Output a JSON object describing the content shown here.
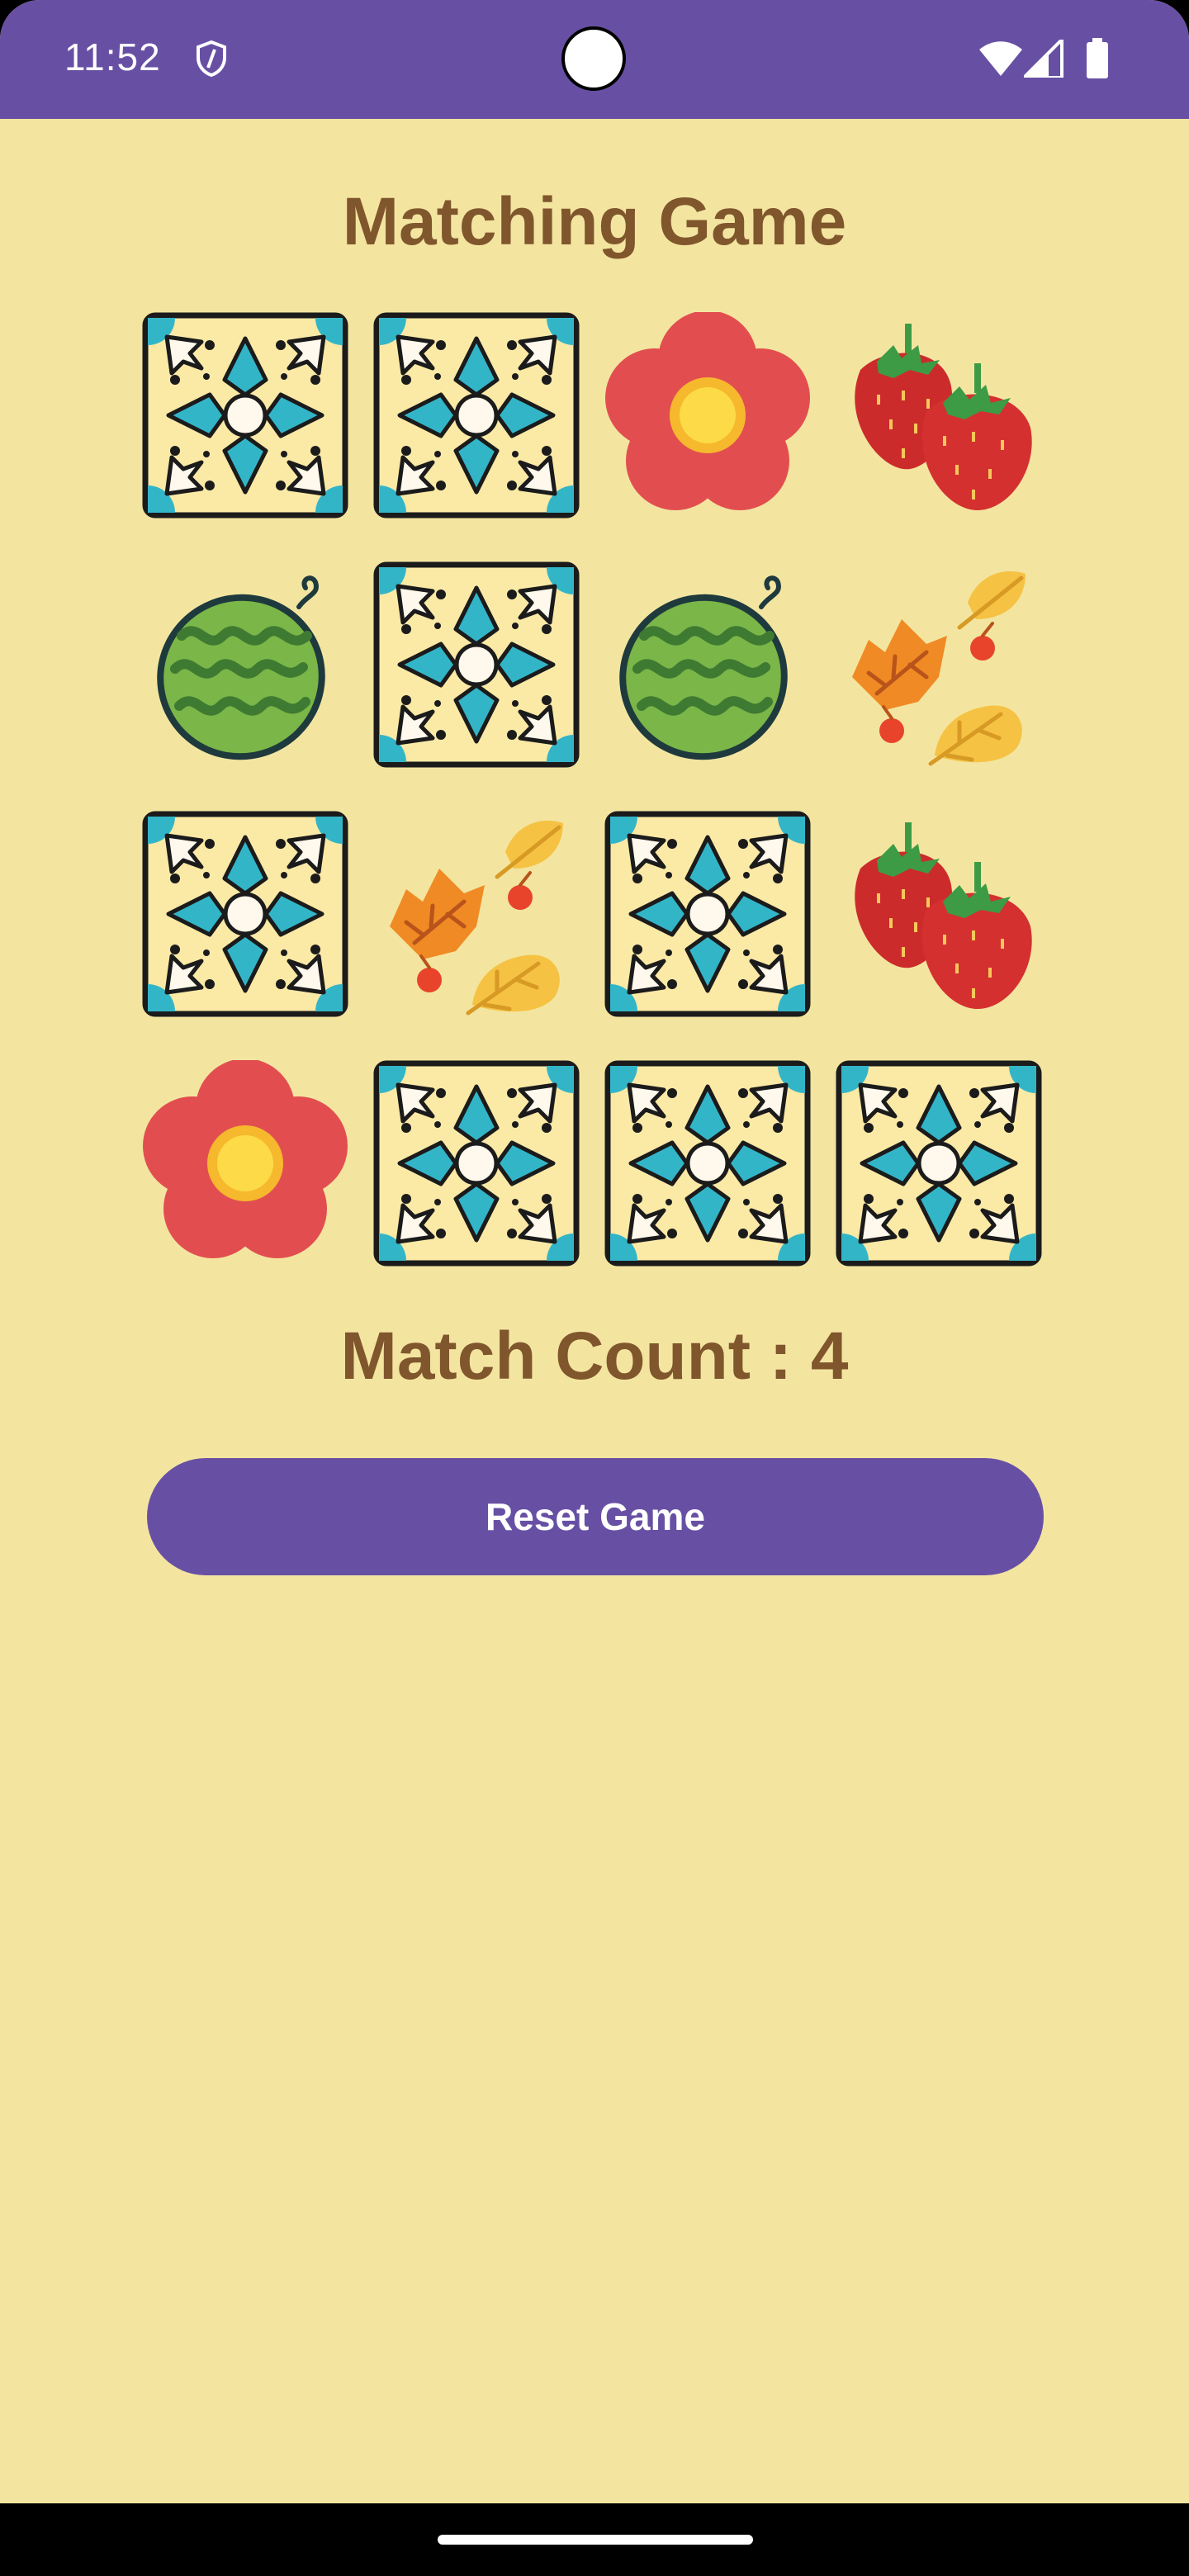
{
  "status_bar": {
    "time": "11:52"
  },
  "app": {
    "title": "Matching Game",
    "match_count_text": "Match Count : 4",
    "reset_label": "Reset Game"
  },
  "colors": {
    "status_bar": "#6750A4",
    "background": "#F3E5A0",
    "title_text": "#80562D",
    "button": "#6750A4"
  },
  "cards": [
    {
      "face": "tile-back"
    },
    {
      "face": "tile-back"
    },
    {
      "face": "flower"
    },
    {
      "face": "strawberries"
    },
    {
      "face": "watermelon"
    },
    {
      "face": "tile-back"
    },
    {
      "face": "watermelon"
    },
    {
      "face": "autumn-leaves"
    },
    {
      "face": "tile-back"
    },
    {
      "face": "autumn-leaves"
    },
    {
      "face": "tile-back"
    },
    {
      "face": "strawberries"
    },
    {
      "face": "flower"
    },
    {
      "face": "tile-back"
    },
    {
      "face": "tile-back"
    },
    {
      "face": "tile-back"
    }
  ]
}
